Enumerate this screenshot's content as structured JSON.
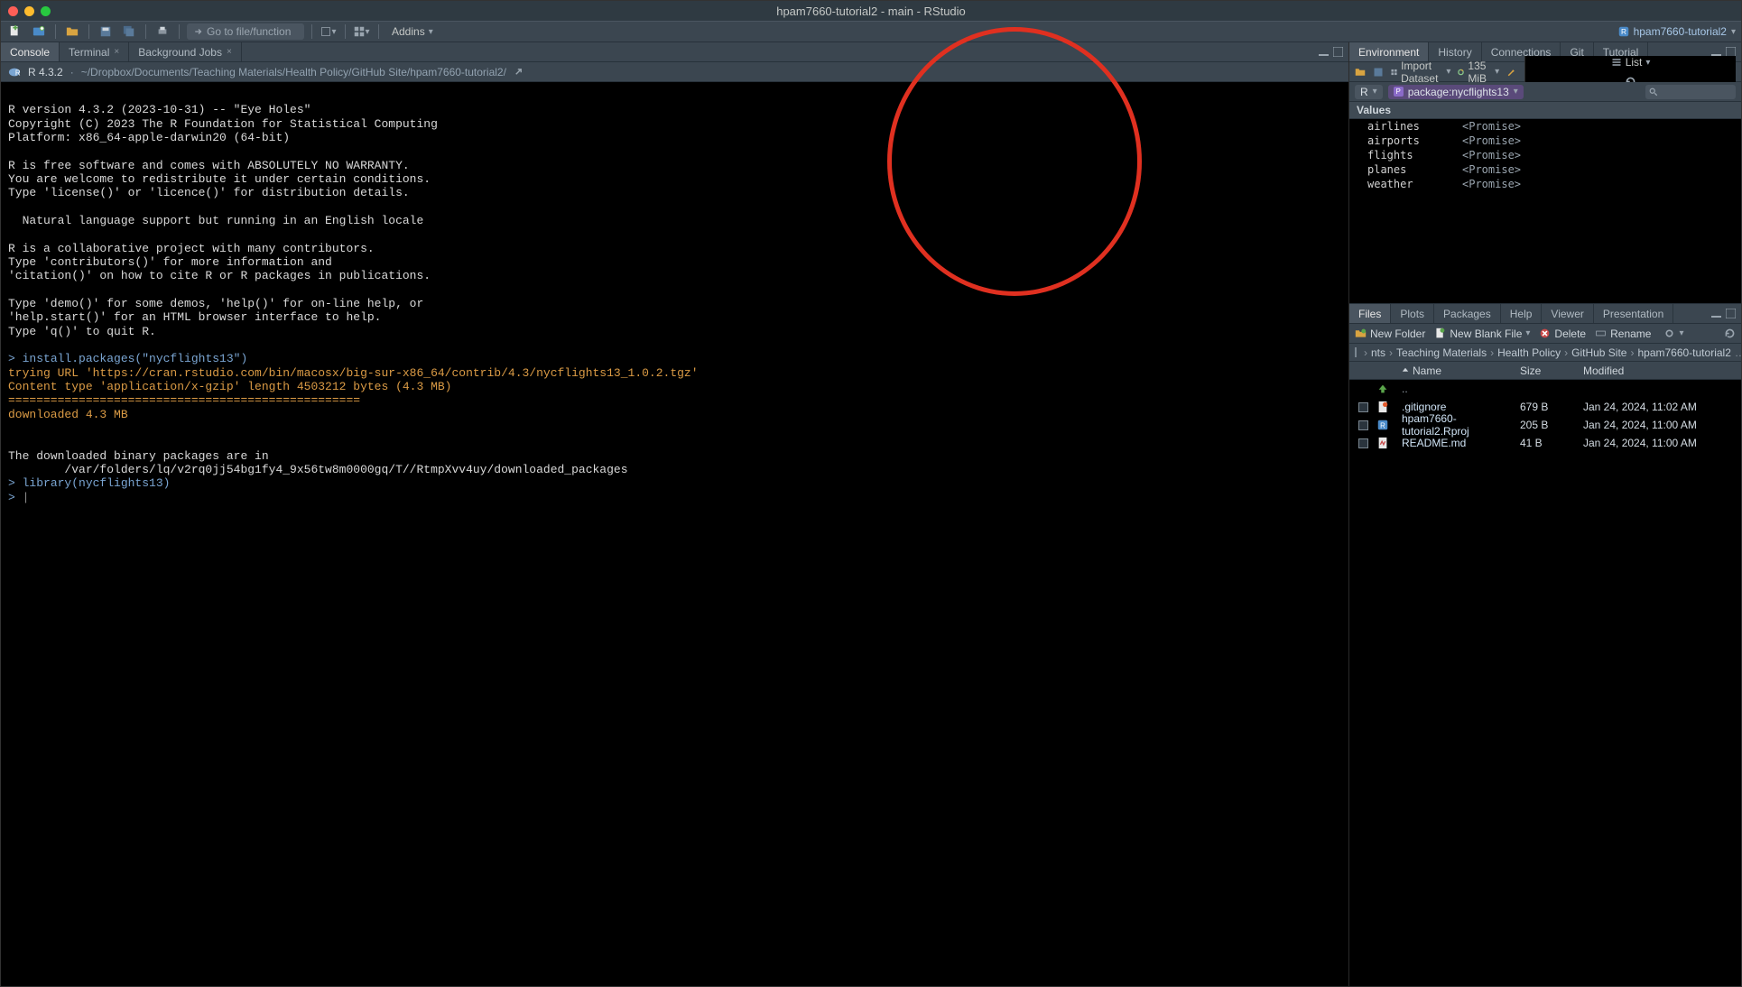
{
  "window": {
    "title": "hpam7660-tutorial2 - main - RStudio"
  },
  "toolbar": {
    "goto_placeholder": "Go to file/function",
    "addins_label": "Addins",
    "project_name": "hpam7660-tutorial2"
  },
  "left_tabs": {
    "console": "Console",
    "terminal": "Terminal",
    "bgjobs": "Background Jobs"
  },
  "pathbar": {
    "r_version": "R 4.3.2",
    "path": "~/Dropbox/Documents/Teaching Materials/Health Policy/GitHub Site/hpam7660-tutorial2/"
  },
  "console_lines": [
    {
      "c": "plain",
      "t": ""
    },
    {
      "c": "plain",
      "t": "R version 4.3.2 (2023-10-31) -- \"Eye Holes\""
    },
    {
      "c": "plain",
      "t": "Copyright (C) 2023 The R Foundation for Statistical Computing"
    },
    {
      "c": "plain",
      "t": "Platform: x86_64-apple-darwin20 (64-bit)"
    },
    {
      "c": "plain",
      "t": ""
    },
    {
      "c": "plain",
      "t": "R is free software and comes with ABSOLUTELY NO WARRANTY."
    },
    {
      "c": "plain",
      "t": "You are welcome to redistribute it under certain conditions."
    },
    {
      "c": "plain",
      "t": "Type 'license()' or 'licence()' for distribution details."
    },
    {
      "c": "plain",
      "t": ""
    },
    {
      "c": "plain",
      "t": "  Natural language support but running in an English locale"
    },
    {
      "c": "plain",
      "t": ""
    },
    {
      "c": "plain",
      "t": "R is a collaborative project with many contributors."
    },
    {
      "c": "plain",
      "t": "Type 'contributors()' for more information and"
    },
    {
      "c": "plain",
      "t": "'citation()' on how to cite R or R packages in publications."
    },
    {
      "c": "plain",
      "t": ""
    },
    {
      "c": "plain",
      "t": "Type 'demo()' for some demos, 'help()' for on-line help, or"
    },
    {
      "c": "plain",
      "t": "'help.start()' for an HTML browser interface to help."
    },
    {
      "c": "plain",
      "t": "Type 'q()' to quit R."
    },
    {
      "c": "plain",
      "t": ""
    },
    {
      "c": "prompt",
      "p": "> ",
      "cmd": "install.packages(\"nycflights13\")"
    },
    {
      "c": "orange",
      "t": "trying URL 'https://cran.rstudio.com/bin/macosx/big-sur-x86_64/contrib/4.3/nycflights13_1.0.2.tgz'"
    },
    {
      "c": "orange",
      "t": "Content type 'application/x-gzip' length 4503212 bytes (4.3 MB)"
    },
    {
      "c": "bar",
      "t": "=================================================="
    },
    {
      "c": "orange",
      "t": "downloaded 4.3 MB"
    },
    {
      "c": "plain",
      "t": ""
    },
    {
      "c": "plain",
      "t": ""
    },
    {
      "c": "plain",
      "t": "The downloaded binary packages are in"
    },
    {
      "c": "plain",
      "t": "        /var/folders/lq/v2rq0jj54bg1fy4_9x56tw8m0000gq/T//RtmpXvv4uy/downloaded_packages"
    },
    {
      "c": "prompt",
      "p": "> ",
      "cmd": "library(nycflights13)"
    },
    {
      "c": "prompt",
      "p": "> ",
      "cmd": ""
    }
  ],
  "right_tabs1": {
    "environment": "Environment",
    "history": "History",
    "connections": "Connections",
    "git": "Git",
    "tutorial": "Tutorial"
  },
  "env_toolbar": {
    "import": "Import Dataset",
    "mem": "135 MiB",
    "list": "List"
  },
  "env_scope": {
    "r": "R",
    "pkg": "package:nycflights13"
  },
  "env_section": "Values",
  "env_values": [
    {
      "name": "airlines",
      "val": "<Promise>"
    },
    {
      "name": "airports",
      "val": "<Promise>"
    },
    {
      "name": "flights",
      "val": "<Promise>"
    },
    {
      "name": "planes",
      "val": "<Promise>"
    },
    {
      "name": "weather",
      "val": "<Promise>"
    }
  ],
  "right_tabs2": {
    "files": "Files",
    "plots": "Plots",
    "packages": "Packages",
    "help": "Help",
    "viewer": "Viewer",
    "presentation": "Presentation"
  },
  "files_toolbar": {
    "new_folder": "New Folder",
    "blank_file": "New Blank File",
    "delete": "Delete",
    "rename": "Rename"
  },
  "breadcrumb": [
    "nts",
    "Teaching Materials",
    "Health Policy",
    "GitHub Site",
    "hpam7660-tutorial2"
  ],
  "file_headers": {
    "name": "Name",
    "size": "Size",
    "modified": "Modified"
  },
  "files": [
    {
      "up": true,
      "name": ".."
    },
    {
      "icon": "git",
      "name": ".gitignore",
      "size": "679 B",
      "modified": "Jan 24, 2024, 11:02 AM"
    },
    {
      "icon": "rproj",
      "name": "hpam7660-tutorial2.Rproj",
      "size": "205 B",
      "modified": "Jan 24, 2024, 11:00 AM"
    },
    {
      "icon": "md",
      "name": "README.md",
      "size": "41 B",
      "modified": "Jan 24, 2024, 11:00 AM"
    }
  ]
}
